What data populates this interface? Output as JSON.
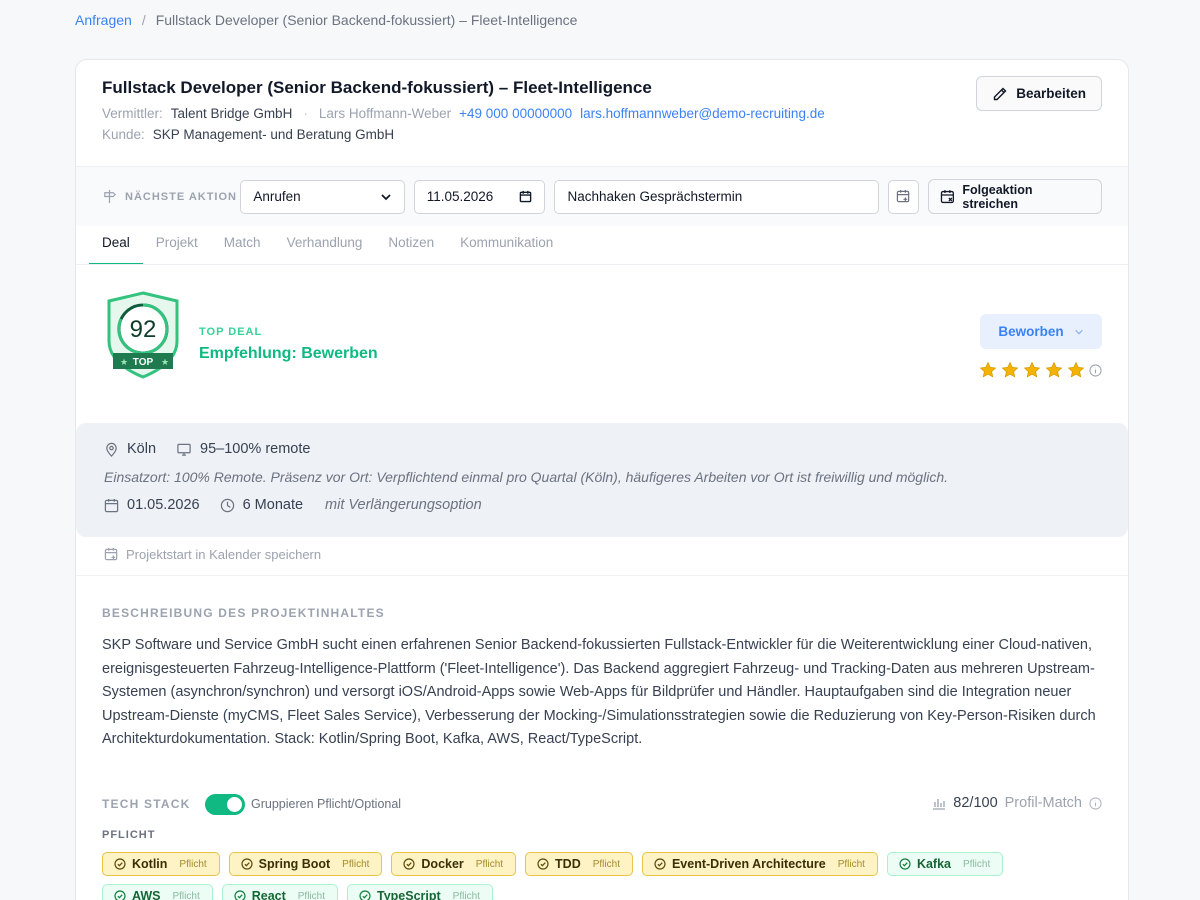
{
  "breadcrumb": {
    "root": "Anfragen",
    "separator": "/",
    "current": "Fullstack Developer (Senior Backend-fokussiert) – Fleet-Intelligence"
  },
  "header": {
    "title": "Fullstack Developer (Senior Backend-fokussiert) – Fleet-Intelligence",
    "vermittler_label": "Vermittler:",
    "vermittler": "Talent Bridge GmbH",
    "separator": "·",
    "contact_name": "Lars Hoffmann-Weber",
    "phone": "+49 000 00000000",
    "email": "lars.hoffmannweber@demo-recruiting.de",
    "kunde_label": "Kunde:",
    "kunde": "SKP Management- und Beratung GmbH",
    "edit_label": "Bearbeiten"
  },
  "action_bar": {
    "label": "NÄCHSTE AKTION",
    "action_value": "Anrufen",
    "date_value": "11.05.2026",
    "note_value": "Nachhaken Gesprächstermin",
    "strike_label": "Folgeaktion streichen"
  },
  "tabs": [
    "Deal",
    "Projekt",
    "Match",
    "Verhandlung",
    "Notizen",
    "Kommunikation"
  ],
  "deal": {
    "score": "92",
    "badge_label": "TOP",
    "subtitle": "TOP DEAL",
    "recommendation": "Empfehlung: Bewerben",
    "status": "Beworben",
    "rating": 5,
    "rating_max": 5
  },
  "location": {
    "city": "Köln",
    "remote": "95–100% remote",
    "note": "Einsatzort: 100% Remote. Präsenz vor Ort: Verpflichtend einmal pro Quartal (Köln), häufigeres Arbeiten vor Ort ist freiwillig und möglich.",
    "start": "01.05.2026",
    "duration": "6 Monate",
    "extension": "mit Verlängerungsoption",
    "calendar_link": "Projektstart in Kalender speichern"
  },
  "description": {
    "heading": "BESCHREIBUNG DES PROJEKTINHALTES",
    "text": "SKP Software und Service GmbH sucht einen erfahrenen Senior Backend-fokussierten Fullstack-Entwickler für die Weiterentwicklung einer Cloud-nativen, ereignisgesteuerten Fahrzeug-Intelligence-Plattform ('Fleet-Intelligence'). Das Backend aggregiert Fahrzeug- und Tracking-Daten aus mehreren Upstream-Systemen (asynchron/synchron) und versorgt iOS/Android-Apps sowie Web-Apps für Bildprüfer und Händler. Hauptaufgaben sind die Integration neuer Upstream-Dienste (myCMS, Fleet Sales Service), Verbesserung der Mocking-/Simulationsstrategien sowie die Reduzierung von Key-Person-Risiken durch Architekturdokumentation. Stack: Kotlin/Spring Boot, Kafka, AWS, React/TypeScript."
  },
  "tech": {
    "heading": "TECH STACK",
    "toggle_label": "Gruppieren Pflicht/Optional",
    "toggle_on": true,
    "match_score": "82/100",
    "match_label": "Profil-Match",
    "group_label": "PFLICHT",
    "chips": [
      {
        "name": "Kotlin",
        "tag": "Pflicht",
        "style": "gold"
      },
      {
        "name": "Spring Boot",
        "tag": "Pflicht",
        "style": "gold"
      },
      {
        "name": "Docker",
        "tag": "Pflicht",
        "style": "gold"
      },
      {
        "name": "TDD",
        "tag": "Pflicht",
        "style": "gold"
      },
      {
        "name": "Event-Driven Architecture",
        "tag": "Pflicht",
        "style": "gold"
      },
      {
        "name": "Kafka",
        "tag": "Pflicht",
        "style": "mint"
      },
      {
        "name": "AWS",
        "tag": "Pflicht",
        "style": "mint"
      },
      {
        "name": "React",
        "tag": "Pflicht",
        "style": "mint"
      },
      {
        "name": "TypeScript",
        "tag": "Pflicht",
        "style": "mint"
      }
    ]
  },
  "colors": {
    "accent_green": "#10b981",
    "link_blue": "#3b82f6",
    "star_gold": "#f5b301"
  }
}
